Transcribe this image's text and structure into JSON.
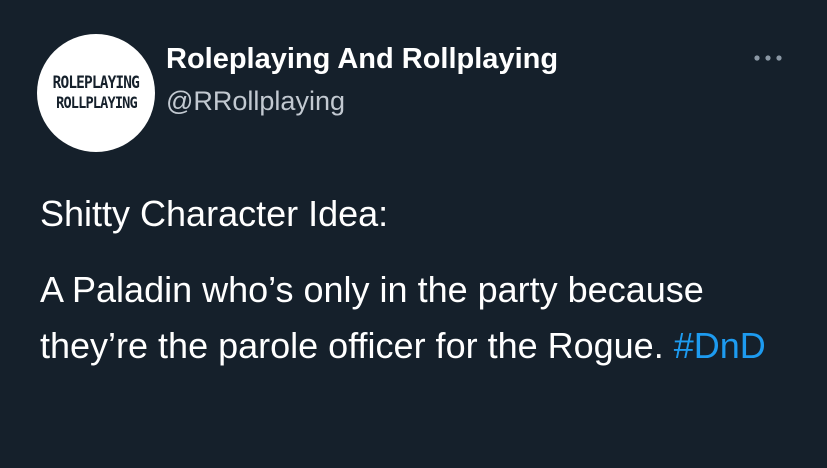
{
  "author": {
    "display_name": "Roleplaying And Rollplaying",
    "handle": "@RRollplaying",
    "avatar_logo_top": "ROLEPLAYING",
    "avatar_logo_bottom": "ROLLPLAYING"
  },
  "menu": {
    "icon": "more-horizontal-icon"
  },
  "tweet": {
    "heading": "Shitty Character Idea:",
    "body": "A Paladin who’s only in the party because they’re the parole officer for the Rogue.",
    "hashtag": "#DnD"
  },
  "colors": {
    "background": "#15202b",
    "text": "#ffffff",
    "secondary_text": "#c2c9d1",
    "link": "#1d9bf0"
  }
}
